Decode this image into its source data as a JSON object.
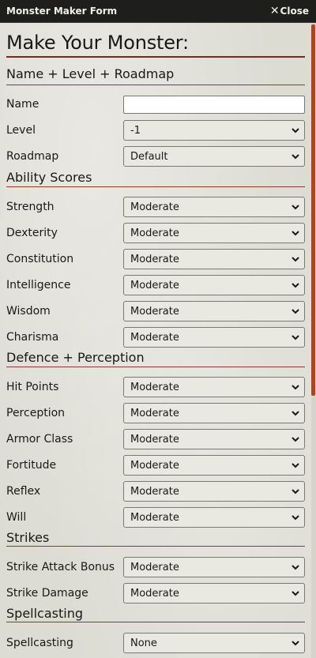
{
  "window": {
    "title": "Monster Maker Form",
    "close_label": "Close"
  },
  "heading": "Make Your Monster:",
  "sections": {
    "name_level": {
      "title": "Name + Level + Roadmap",
      "name_label": "Name",
      "name_value": "",
      "level_label": "Level",
      "level_value": "-1",
      "roadmap_label": "Roadmap",
      "roadmap_value": "Default"
    },
    "abilities": {
      "title": "Ability Scores",
      "rows": [
        {
          "label": "Strength",
          "value": "Moderate"
        },
        {
          "label": "Dexterity",
          "value": "Moderate"
        },
        {
          "label": "Constitution",
          "value": "Moderate"
        },
        {
          "label": "Intelligence",
          "value": "Moderate"
        },
        {
          "label": "Wisdom",
          "value": "Moderate"
        },
        {
          "label": "Charisma",
          "value": "Moderate"
        }
      ]
    },
    "defence": {
      "title": "Defence + Perception",
      "rows": [
        {
          "label": "Hit Points",
          "value": "Moderate"
        },
        {
          "label": "Perception",
          "value": "Moderate"
        },
        {
          "label": "Armor Class",
          "value": "Moderate"
        },
        {
          "label": "Fortitude",
          "value": "Moderate"
        },
        {
          "label": "Reflex",
          "value": "Moderate"
        },
        {
          "label": "Will",
          "value": "Moderate"
        }
      ]
    },
    "strikes": {
      "title": "Strikes",
      "rows": [
        {
          "label": "Strike Attack Bonus",
          "value": "Moderate"
        },
        {
          "label": "Strike Damage",
          "value": "Moderate"
        }
      ]
    },
    "spellcasting": {
      "title": "Spellcasting",
      "rows": [
        {
          "label": "Spellcasting",
          "value": "None"
        }
      ]
    }
  },
  "colors": {
    "accent_rule": "#7b2a20",
    "titlebar": "#1e1e1c",
    "scrollbar_thumb": "#b0431c"
  }
}
